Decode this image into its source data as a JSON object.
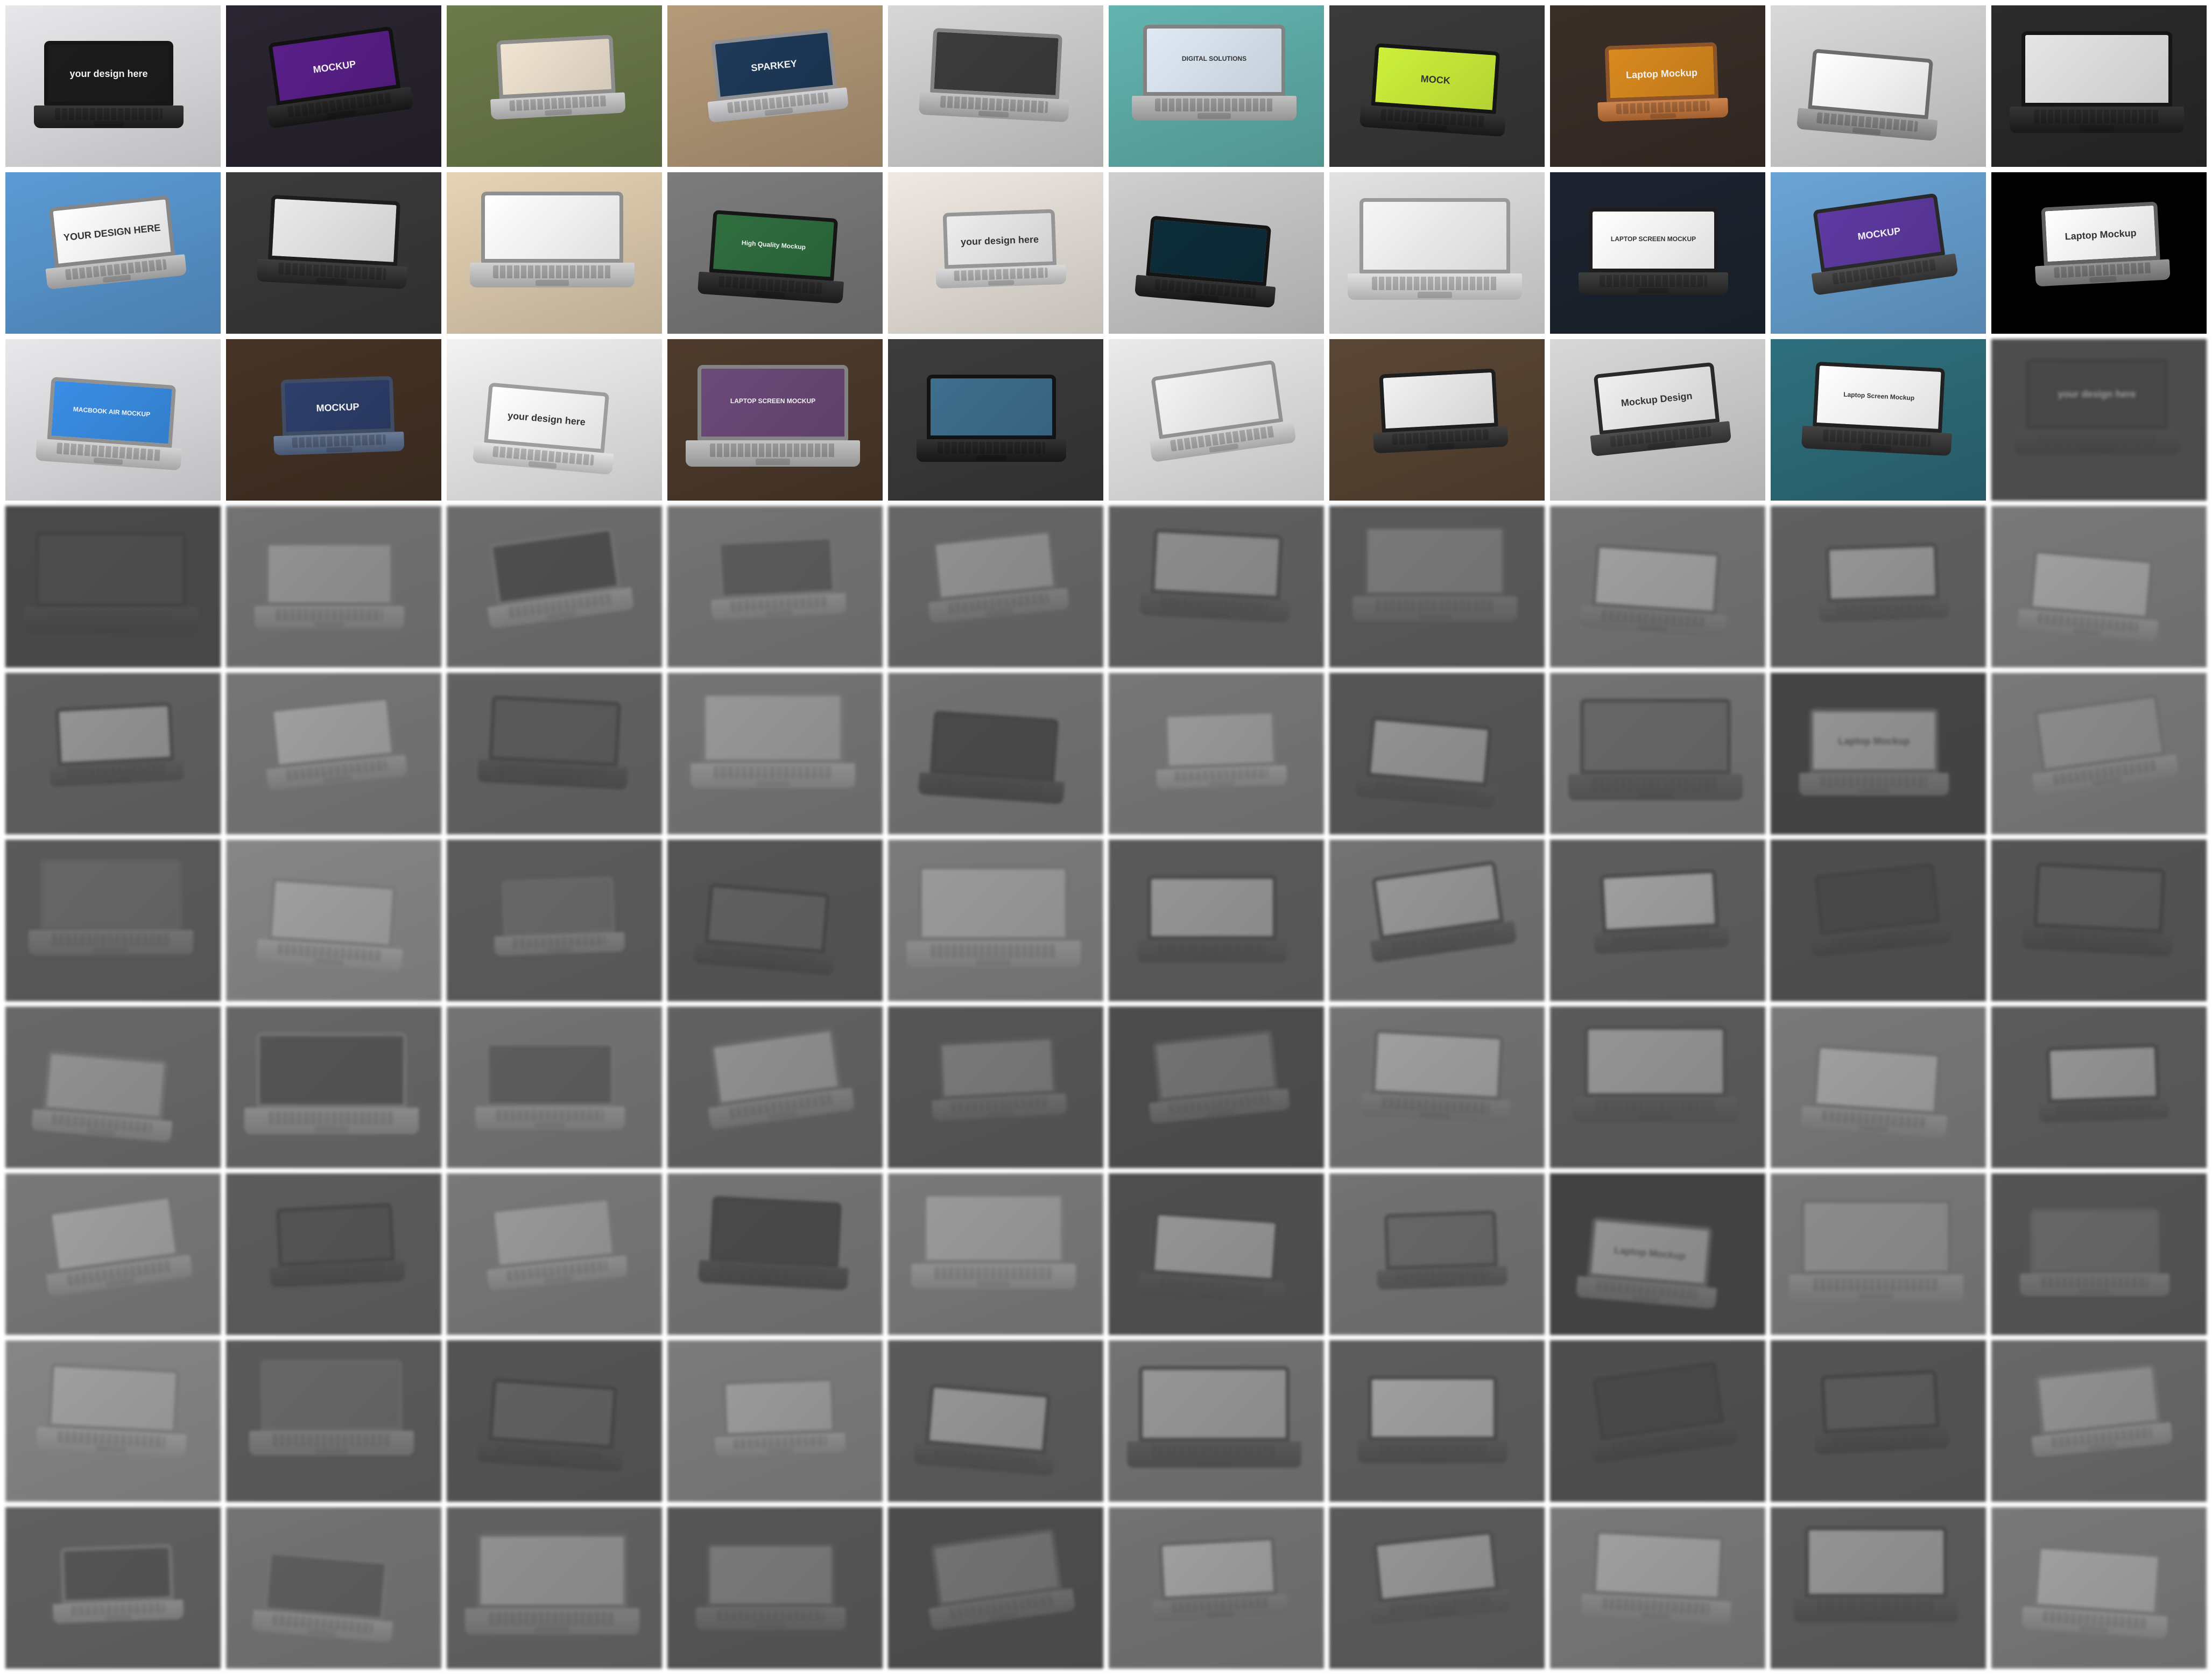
{
  "gallery": {
    "tiles": [
      {
        "bg": "#e8e8ea",
        "screen": "#1c1c1c",
        "body": "#202020",
        "caption": "your design here",
        "dim": false
      },
      {
        "bg": "#2a2530",
        "screen": "#5a1f8a",
        "body": "#1a1a1a",
        "caption": "MOCKUP",
        "dim": false
      },
      {
        "bg": "#6d7b4a",
        "screen": "#f1e4d2",
        "body": "#c9c9c9",
        "caption": "",
        "dim": false
      },
      {
        "bg": "#b69b7a",
        "screen": "#1e3a5a",
        "body": "#cfcfd2",
        "caption": "SPARKEY",
        "dim": false
      },
      {
        "bg": "#d7d7d7",
        "screen": "#3c3c3c",
        "body": "#bdbdbd",
        "caption": "",
        "dim": false
      },
      {
        "bg": "#63b4b0",
        "screen": "#dfeaf5",
        "body": "#b9b9b9",
        "caption": "DIGITAL SOLUTIONS",
        "dim": false
      },
      {
        "bg": "#3a3a3a",
        "screen": "#cdf03a",
        "body": "#1e1e1e",
        "caption": "MOCK",
        "dim": false
      },
      {
        "bg": "#3a2e28",
        "screen": "#d98a1f",
        "body": "#c9773a",
        "caption": "Laptop Mockup",
        "dim": false
      },
      {
        "bg": "#d9d9d9",
        "screen": "#ffffff",
        "body": "#9a9a9a",
        "caption": "",
        "dim": false
      },
      {
        "bg": "#2b2b2b",
        "screen": "#e5e5e5",
        "body": "#1f1f1f",
        "caption": "",
        "dim": false
      },
      {
        "bg": "#5b9bd5",
        "screen": "#ffffff",
        "body": "#bfbfbf",
        "caption": "YOUR DESIGN HERE",
        "dim": false
      },
      {
        "bg": "#3b3b3b",
        "screen": "#eaeaea",
        "body": "#2a2a2a",
        "caption": "",
        "dim": false
      },
      {
        "bg": "#e6d3b4",
        "screen": "#ffffff",
        "body": "#cdcdcd",
        "caption": "",
        "dim": false
      },
      {
        "bg": "#7c7c7c",
        "screen": "#2f6e3f",
        "body": "#202020",
        "caption": "High Quality Mockup",
        "dim": false
      },
      {
        "bg": "#f0e9e2",
        "screen": "#ededed",
        "body": "#d6d6d6",
        "caption": "your design here",
        "dim": false
      },
      {
        "bg": "#cfcfcf",
        "screen": "#0d2d3a",
        "body": "#1d1d1d",
        "caption": "",
        "dim": false
      },
      {
        "bg": "#e2e2e2",
        "screen": "#f6f6f6",
        "body": "#dcdcdc",
        "caption": "",
        "dim": false
      },
      {
        "bg": "#1d2430",
        "screen": "#ffffff",
        "body": "#2a2a2a",
        "caption": "LAPTOP SCREEN MOCKUP",
        "dim": false
      },
      {
        "bg": "#6aa4d6",
        "screen": "#5f3aa3",
        "body": "#3b3b3b",
        "caption": "MOCKUP",
        "dim": false
      },
      {
        "bg": "#000000",
        "screen": "#ffffff",
        "body": "#8a8a8a",
        "caption": "Laptop Mockup",
        "dim": false
      },
      {
        "bg": "#e9e9ec",
        "screen": "#3a8ee6",
        "body": "#cfcfcf",
        "caption": "MACBOOK AIR MOCKUP",
        "dim": false
      },
      {
        "bg": "#463326",
        "screen": "#2d3f6b",
        "body": "#5a6d8e",
        "caption": "MOCKUP",
        "dim": false
      },
      {
        "bg": "#f2f2f2",
        "screen": "#ffffff",
        "body": "#e0e0e0",
        "caption": "your design here",
        "dim": false
      },
      {
        "bg": "#4e3b2c",
        "screen": "#6b4a78",
        "body": "#bbbbbb",
        "caption": "LAPTOP SCREEN MOCKUP",
        "dim": false
      },
      {
        "bg": "#3c3c3c",
        "screen": "#3e6f8e",
        "body": "#1b1b1b",
        "caption": "",
        "dim": false
      },
      {
        "bg": "#ebebeb",
        "screen": "#f3f3f3",
        "body": "#cfcfcf",
        "caption": "",
        "dim": false
      },
      {
        "bg": "#5a4634",
        "screen": "#f1f1f1",
        "body": "#2b2b2b",
        "caption": "",
        "dim": false
      },
      {
        "bg": "#d8d8d8",
        "screen": "#efefef",
        "body": "#3a3a3a",
        "caption": "Mockup Design",
        "dim": false
      },
      {
        "bg": "#2f6f7d",
        "screen": "#ffffff",
        "body": "#2f2f2f",
        "caption": "Laptop Screen Mockup",
        "dim": false
      },
      {
        "bg": "#2a2a2a",
        "screen": "#1b1b1b",
        "body": "#141414",
        "caption": "your design here",
        "dim": true
      },
      {
        "bg": "#1e1e1e",
        "screen": "#2a2a2a",
        "body": "#151515",
        "caption": "",
        "dim": true
      },
      {
        "bg": "#8a8a8a",
        "screen": "#dcdcdc",
        "body": "#bcbcbc",
        "caption": "",
        "dim": true
      },
      {
        "bg": "#7a7a7a",
        "screen": "#2a2a2a",
        "body": "#bdbdbd",
        "caption": "",
        "dim": true
      },
      {
        "bg": "#8d8d8d",
        "screen": "#4a4a4a",
        "body": "#bfbfbf",
        "caption": "",
        "dim": true
      },
      {
        "bg": "#6a6a6a",
        "screen": "#d9d9d9",
        "body": "#9c9c9c",
        "caption": "",
        "dim": true
      },
      {
        "bg": "#595959",
        "screen": "#cfcfcf",
        "body": "#333333",
        "caption": "",
        "dim": true
      },
      {
        "bg": "#474747",
        "screen": "#9a9a9a",
        "body": "#6e6e6e",
        "caption": "",
        "dim": true
      },
      {
        "bg": "#8c8c8c",
        "screen": "#ffffff",
        "body": "#8a8a8a",
        "caption": "",
        "dim": true
      },
      {
        "bg": "#5a5a5a",
        "screen": "#e4e4e4",
        "body": "#3a3a3a",
        "caption": "",
        "dim": true
      },
      {
        "bg": "#9a9a9a",
        "screen": "#ffffff",
        "body": "#b8b8b8",
        "caption": "",
        "dim": true
      },
      {
        "bg": "#5a5a5a",
        "screen": "#e0e0e0",
        "body": "#333333",
        "caption": "",
        "dim": true
      },
      {
        "bg": "#929292",
        "screen": "#ffffff",
        "body": "#c2c2c2",
        "caption": "",
        "dim": true
      },
      {
        "bg": "#5f5f5f",
        "screen": "#4a4a4a",
        "body": "#222222",
        "caption": "",
        "dim": true
      },
      {
        "bg": "#8f8f8f",
        "screen": "#eaeaea",
        "body": "#cfcfcf",
        "caption": "",
        "dim": true
      },
      {
        "bg": "#8a8a8a",
        "screen": "#1e1e1e",
        "body": "#1a1a1a",
        "caption": "",
        "dim": true
      },
      {
        "bg": "#959595",
        "screen": "#ededed",
        "body": "#d0d0d0",
        "caption": "",
        "dim": true
      },
      {
        "bg": "#3e3e3e",
        "screen": "#dcdcdc",
        "body": "#262626",
        "caption": "",
        "dim": true
      },
      {
        "bg": "#8b8b8b",
        "screen": "#6a6a6a",
        "body": "#3b3b3b",
        "caption": "",
        "dim": true
      },
      {
        "bg": "#111111",
        "screen": "#e0e0e0",
        "body": "#7a7a7a",
        "caption": "Laptop Mockup",
        "dim": true
      },
      {
        "bg": "#9a9a9a",
        "screen": "#c9c9c9",
        "body": "#b5b5b5",
        "caption": "",
        "dim": true
      },
      {
        "bg": "#4a4a4a",
        "screen": "#6a6a6a",
        "body": "#808080",
        "caption": "",
        "dim": true
      },
      {
        "bg": "#bdbdbd",
        "screen": "#ffffff",
        "body": "#dedede",
        "caption": "",
        "dim": true
      },
      {
        "bg": "#4e4e4e",
        "screen": "#6c6c6c",
        "body": "#9c9c9c",
        "caption": "",
        "dim": true
      },
      {
        "bg": "#3c3c3c",
        "screen": "#5a5a5a",
        "body": "#1c1c1c",
        "caption": "",
        "dim": true
      },
      {
        "bg": "#a1a1a1",
        "screen": "#f1f1f1",
        "body": "#cacaca",
        "caption": "",
        "dim": true
      },
      {
        "bg": "#4a4a4a",
        "screen": "#e3e3e3",
        "body": "#2b2b2b",
        "caption": "",
        "dim": true
      },
      {
        "bg": "#8a8a8a",
        "screen": "#e5e5e5",
        "body": "#333333",
        "caption": "",
        "dim": true
      },
      {
        "bg": "#535353",
        "screen": "#ffffff",
        "body": "#2a2a2a",
        "caption": "",
        "dim": true
      },
      {
        "bg": "#2c2c2c",
        "screen": "#1c1c1c",
        "body": "#141414",
        "caption": "",
        "dim": true
      },
      {
        "bg": "#3a3a3a",
        "screen": "#4a4a4a",
        "body": "#1a1a1a",
        "caption": "",
        "dim": true
      },
      {
        "bg": "#6e6e6e",
        "screen": "#dadada",
        "body": "#bdbdbd",
        "caption": "",
        "dim": true
      },
      {
        "bg": "#6a6a6a",
        "screen": "#3a3a3a",
        "body": "#c3c3c3",
        "caption": "",
        "dim": true
      },
      {
        "bg": "#8c8c8c",
        "screen": "#505050",
        "body": "#c0c0c0",
        "caption": "",
        "dim": true
      },
      {
        "bg": "#5e5e5e",
        "screen": "#d8d8d8",
        "body": "#9d9d9d",
        "caption": "",
        "dim": true
      },
      {
        "bg": "#3e3e3e",
        "screen": "#9a9a9a",
        "body": "#6a6a6a",
        "caption": "",
        "dim": true
      },
      {
        "bg": "#262626",
        "screen": "#8a8a8a",
        "body": "#6a6a6a",
        "caption": "",
        "dim": true
      },
      {
        "bg": "#8a8a8a",
        "screen": "#ffffff",
        "body": "#8a8a8a",
        "caption": "",
        "dim": true
      },
      {
        "bg": "#4a4a4a",
        "screen": "#e2e2e2",
        "body": "#3c3c3c",
        "caption": "",
        "dim": true
      },
      {
        "bg": "#9a9a9a",
        "screen": "#ffffff",
        "body": "#b8b8b8",
        "caption": "",
        "dim": true
      },
      {
        "bg": "#4c4c4c",
        "screen": "#e0e0e0",
        "body": "#2c2c2c",
        "caption": "",
        "dim": true
      },
      {
        "bg": "#999999",
        "screen": "#ffffff",
        "body": "#cccccc",
        "caption": "",
        "dim": true
      },
      {
        "bg": "#4e4e4e",
        "screen": "#3a3a3a",
        "body": "#1e1e1e",
        "caption": "",
        "dim": true
      },
      {
        "bg": "#999999",
        "screen": "#ececec",
        "body": "#cdcdcd",
        "caption": "",
        "dim": true
      },
      {
        "bg": "#8f8f8f",
        "screen": "#1e1e1e",
        "body": "#1b1b1b",
        "caption": "",
        "dim": true
      },
      {
        "bg": "#9a9a9a",
        "screen": "#f0f0f0",
        "body": "#d6d6d6",
        "caption": "",
        "dim": true
      },
      {
        "bg": "#2e2e2e",
        "screen": "#e2e2e2",
        "body": "#2a2a2a",
        "caption": "",
        "dim": true
      },
      {
        "bg": "#8a8a8a",
        "screen": "#6a6a6a",
        "body": "#3b3b3b",
        "caption": "",
        "dim": true
      },
      {
        "bg": "#0d0d0d",
        "screen": "#dcdcdc",
        "body": "#7a7a7a",
        "caption": "Laptop Mockup",
        "dim": true
      },
      {
        "bg": "#9a9a9a",
        "screen": "#cdcdcd",
        "body": "#b5b5b5",
        "caption": "",
        "dim": true
      },
      {
        "bg": "#3a3a3a",
        "screen": "#6a6a6a",
        "body": "#808080",
        "caption": "",
        "dim": true
      },
      {
        "bg": "#bdbdbd",
        "screen": "#ffffff",
        "body": "#dddddd",
        "caption": "",
        "dim": true
      },
      {
        "bg": "#4a4a4a",
        "screen": "#6a6a6a",
        "body": "#9a9a9a",
        "caption": "",
        "dim": true
      },
      {
        "bg": "#3a3a3a",
        "screen": "#5a5a5a",
        "body": "#1c1c1c",
        "caption": "",
        "dim": true
      },
      {
        "bg": "#a2a2a2",
        "screen": "#f1f1f1",
        "body": "#cacaca",
        "caption": "",
        "dim": true
      },
      {
        "bg": "#4a4a4a",
        "screen": "#e3e3e3",
        "body": "#2b2b2b",
        "caption": "",
        "dim": true
      },
      {
        "bg": "#8a8a8a",
        "screen": "#e5e5e5",
        "body": "#333333",
        "caption": "",
        "dim": true
      },
      {
        "bg": "#525252",
        "screen": "#ffffff",
        "body": "#2a2a2a",
        "caption": "",
        "dim": true
      },
      {
        "bg": "#2c2c2c",
        "screen": "#1c1c1c",
        "body": "#141414",
        "caption": "",
        "dim": true
      },
      {
        "bg": "#3a3a3a",
        "screen": "#4a4a4a",
        "body": "#1a1a1a",
        "caption": "",
        "dim": true
      },
      {
        "bg": "#6e6e6e",
        "screen": "#dadada",
        "body": "#bdbdbd",
        "caption": "",
        "dim": true
      },
      {
        "bg": "#5a5a5a",
        "screen": "#3a3a3a",
        "body": "#c3c3c3",
        "caption": "",
        "dim": true
      },
      {
        "bg": "#8c8c8c",
        "screen": "#505050",
        "body": "#c0c0c0",
        "caption": "",
        "dim": true
      },
      {
        "bg": "#5e5e5e",
        "screen": "#d8d8d8",
        "body": "#9d9d9d",
        "caption": "",
        "dim": true
      },
      {
        "bg": "#3e3e3e",
        "screen": "#9a9a9a",
        "body": "#6a6a6a",
        "caption": "",
        "dim": true
      },
      {
        "bg": "#262626",
        "screen": "#8a8a8a",
        "body": "#6a6a6a",
        "caption": "",
        "dim": true
      },
      {
        "bg": "#8a8a8a",
        "screen": "#ffffff",
        "body": "#8a8a8a",
        "caption": "",
        "dim": true
      },
      {
        "bg": "#4a4a4a",
        "screen": "#e2e2e2",
        "body": "#3c3c3c",
        "caption": "",
        "dim": true
      },
      {
        "bg": "#9a9a9a",
        "screen": "#ffffff",
        "body": "#b8b8b8",
        "caption": "",
        "dim": true
      },
      {
        "bg": "#4c4c4c",
        "screen": "#e0e0e0",
        "body": "#2c2c2c",
        "caption": "",
        "dim": true
      },
      {
        "bg": "#999999",
        "screen": "#ffffff",
        "body": "#cccccc",
        "caption": "",
        "dim": true
      }
    ]
  }
}
